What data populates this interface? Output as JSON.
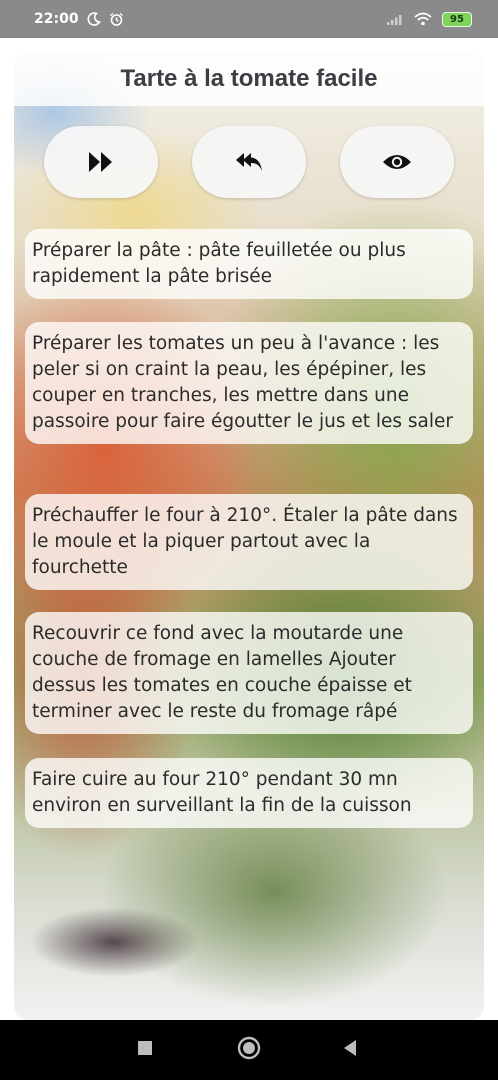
{
  "status_bar": {
    "time": "22:00",
    "battery": "95",
    "icons": [
      "moon-icon",
      "alarm-icon",
      "signal-icon",
      "wifi-icon",
      "battery-icon"
    ]
  },
  "recipe": {
    "title": "Tarte à la tomate facile"
  },
  "toolbar": {
    "buttons": [
      {
        "icon": "fast-forward-icon"
      },
      {
        "icon": "reply-all-icon"
      },
      {
        "icon": "eye-icon"
      }
    ]
  },
  "steps": [
    {
      "text": "Préparer la pâte :  pâte feuilletée ou plus rapidement la pâte brisée"
    },
    {
      "text": "Préparer les tomates un peu à l'avance : les peler si on craint la peau, les épépiner, les couper en tranches, les mettre dans une passoire pour faire égoutter le jus et les saler"
    },
    {
      "text": "Préchauffer le four à 210°. Étaler la pâte dans le moule et la piquer partout avec la fourchette"
    },
    {
      "text": "Recouvrir ce fond avec la moutarde  une couche de fromage en lamelles  Ajouter dessus les tomates en couche épaisse et terminer avec le reste du fromage râpé"
    },
    {
      "text": "Faire cuire au four 210° pendant 30 mn environ en surveillant la fin de la cuisson"
    }
  ],
  "nav_bar": {
    "icons": [
      "recents-icon",
      "home-icon",
      "back-icon"
    ]
  },
  "colors": {
    "status_bar": "#8a8a8a",
    "battery": "#7fd35a",
    "title_text": "#3b3e44",
    "nav_bar": "#000000"
  }
}
